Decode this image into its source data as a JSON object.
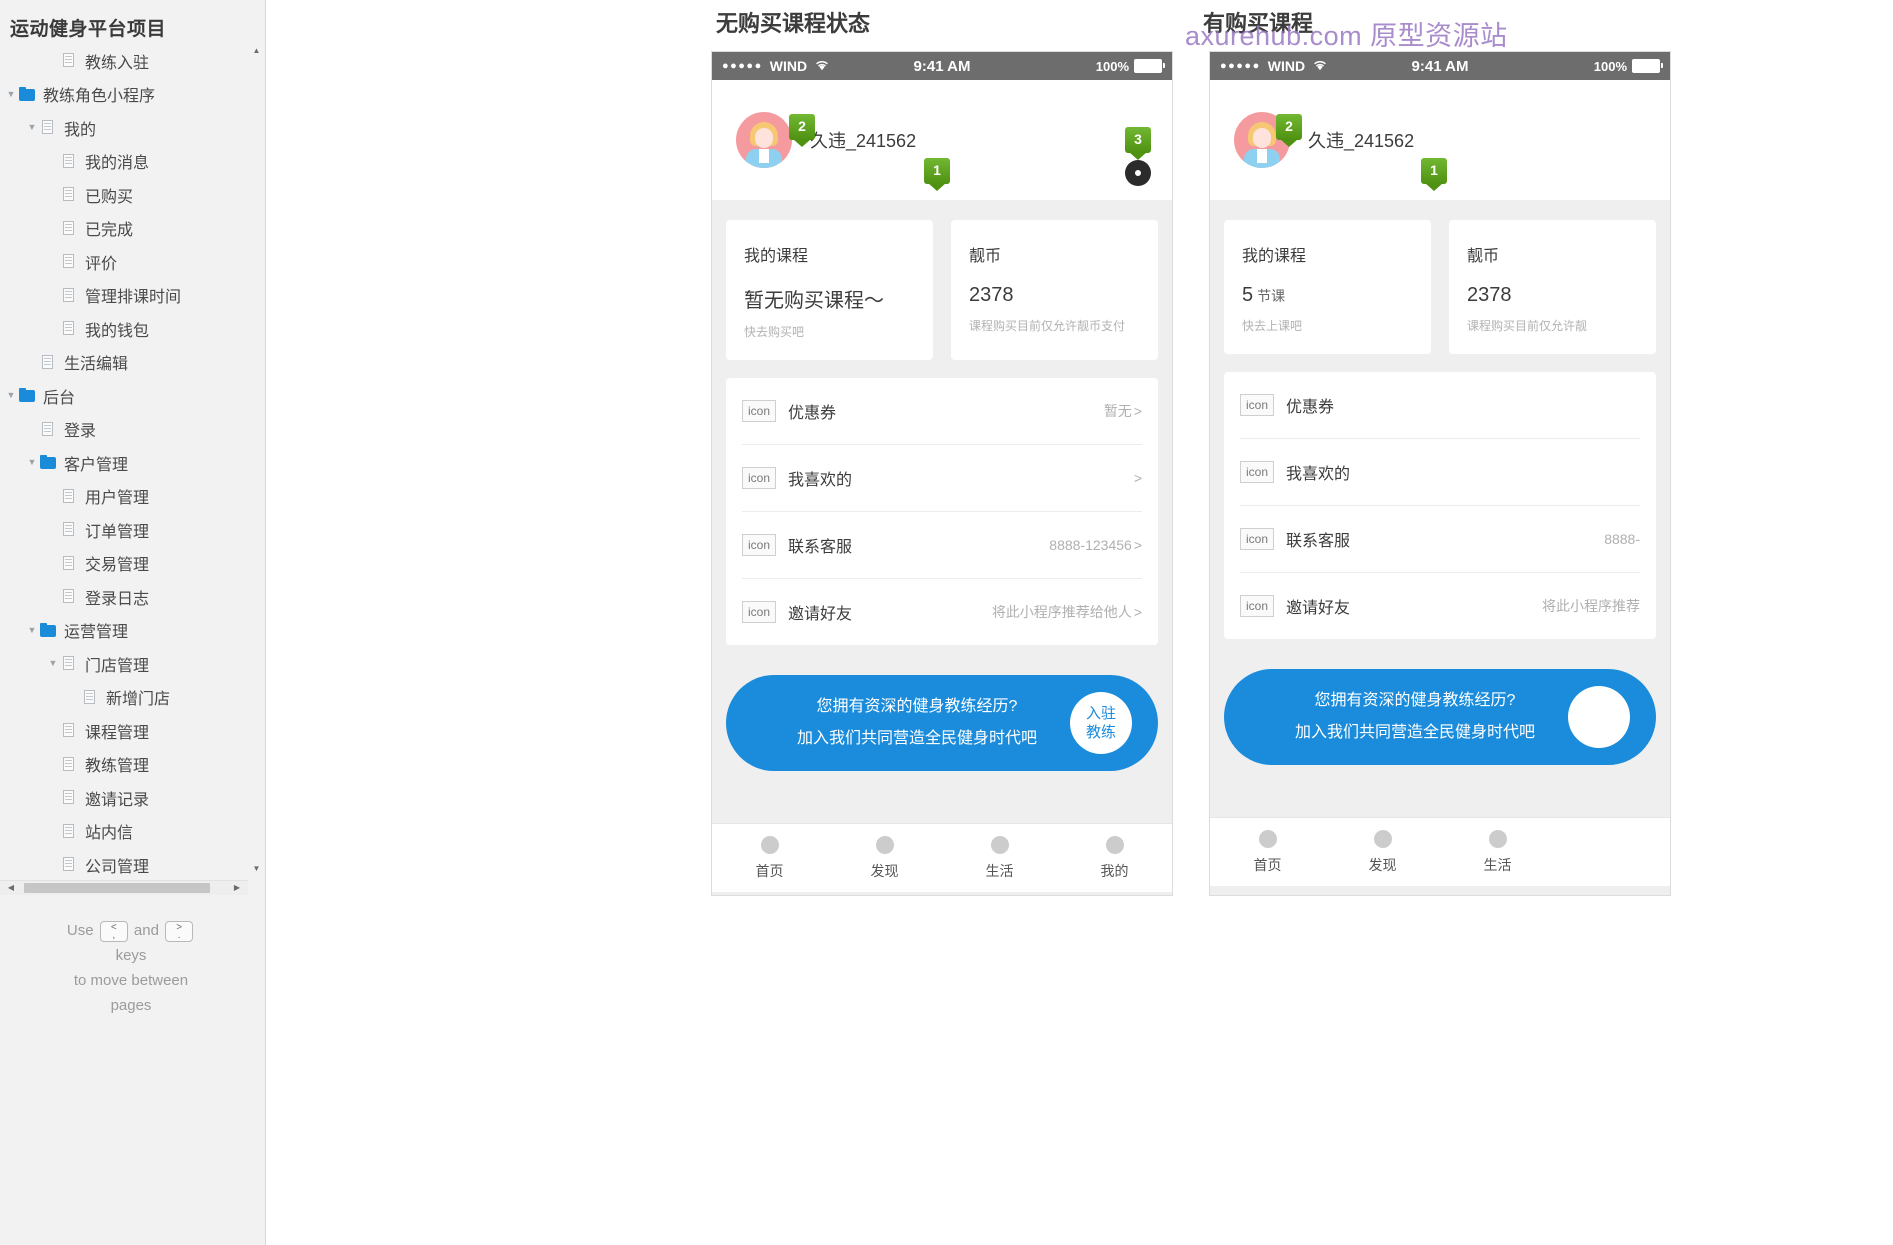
{
  "sidebar": {
    "title": "运动健身平台项目",
    "tree": [
      {
        "label": "教练入驻",
        "depth": 2,
        "icon": "page",
        "twisty": "none"
      },
      {
        "label": "教练角色小程序",
        "depth": 0,
        "icon": "folder",
        "twisty": "open"
      },
      {
        "label": "我的",
        "depth": 1,
        "icon": "page",
        "twisty": "open"
      },
      {
        "label": "我的消息",
        "depth": 2,
        "icon": "page",
        "twisty": "none"
      },
      {
        "label": "已购买",
        "depth": 2,
        "icon": "page",
        "twisty": "none"
      },
      {
        "label": "已完成",
        "depth": 2,
        "icon": "page",
        "twisty": "none"
      },
      {
        "label": "评价",
        "depth": 2,
        "icon": "page",
        "twisty": "none"
      },
      {
        "label": "管理排课时间",
        "depth": 2,
        "icon": "page",
        "twisty": "none"
      },
      {
        "label": "我的钱包",
        "depth": 2,
        "icon": "page",
        "twisty": "none"
      },
      {
        "label": "生活编辑",
        "depth": 1,
        "icon": "page",
        "twisty": "none"
      },
      {
        "label": "后台",
        "depth": 0,
        "icon": "folder",
        "twisty": "open"
      },
      {
        "label": "登录",
        "depth": 1,
        "icon": "page",
        "twisty": "none"
      },
      {
        "label": "客户管理",
        "depth": 1,
        "icon": "folder",
        "twisty": "open"
      },
      {
        "label": "用户管理",
        "depth": 2,
        "icon": "page",
        "twisty": "none"
      },
      {
        "label": "订单管理",
        "depth": 2,
        "icon": "page",
        "twisty": "none"
      },
      {
        "label": "交易管理",
        "depth": 2,
        "icon": "page",
        "twisty": "none"
      },
      {
        "label": "登录日志",
        "depth": 2,
        "icon": "page",
        "twisty": "none"
      },
      {
        "label": "运营管理",
        "depth": 1,
        "icon": "folder",
        "twisty": "open"
      },
      {
        "label": "门店管理",
        "depth": 2,
        "icon": "page",
        "twisty": "open"
      },
      {
        "label": "新增门店",
        "depth": 3,
        "icon": "page",
        "twisty": "none"
      },
      {
        "label": "课程管理",
        "depth": 2,
        "icon": "page",
        "twisty": "none"
      },
      {
        "label": "教练管理",
        "depth": 2,
        "icon": "page",
        "twisty": "none"
      },
      {
        "label": "邀请记录",
        "depth": 2,
        "icon": "page",
        "twisty": "none"
      },
      {
        "label": "站内信",
        "depth": 2,
        "icon": "page",
        "twisty": "none"
      },
      {
        "label": "公司管理",
        "depth": 2,
        "icon": "page",
        "twisty": "none"
      }
    ],
    "hint": {
      "use": "Use",
      "and": "and",
      "key_prev_top": "<",
      "key_prev_bottom": ",",
      "key_next_top": ">",
      "key_next_bottom": ".",
      "line2": "keys",
      "line3": "to move between",
      "line4": "pages"
    }
  },
  "watermark": "axurehub.com 原型资源站",
  "panels": [
    {
      "title": "无购买课程状态"
    },
    {
      "title": "有购买课程"
    }
  ],
  "phone_left": {
    "statusbar": {
      "dots": "●●●●●",
      "carrier": "WIND",
      "wifi": "wifi-icon",
      "time": "9:41 AM",
      "battery_text": "100%",
      "battery_icon": "battery-full-icon"
    },
    "profile": {
      "avatar": "user-avatar",
      "username": "久违_241562"
    },
    "markers": [
      {
        "id": "1",
        "label": "1"
      },
      {
        "id": "2",
        "label": "2"
      },
      {
        "id": "3",
        "label": "3"
      }
    ],
    "cards": [
      {
        "title": "我的课程",
        "value": "暂无购买课程～",
        "unit": "",
        "sub": "快去购买吧"
      },
      {
        "title": "靓币",
        "value": "2378",
        "unit": "",
        "sub": "课程购买目前仅允许靓币支付"
      }
    ],
    "menu": [
      {
        "icon": "icon",
        "label": "优惠券",
        "value": "暂无",
        "chev": ">"
      },
      {
        "icon": "icon",
        "label": "我喜欢的",
        "value": "",
        "chev": ">"
      },
      {
        "icon": "icon",
        "label": "联系客服",
        "value": "8888-123456",
        "chev": ">"
      },
      {
        "icon": "icon",
        "label": "邀请好友",
        "value": "将此小程序推荐给他人",
        "chev": ">"
      }
    ],
    "cta": {
      "line1": "您拥有资深的健身教练经历?",
      "line2": "加入我们共同营造全民健身时代吧",
      "badge_line1": "入驻",
      "badge_line2": "教练"
    },
    "tabs": [
      {
        "label": "首页"
      },
      {
        "label": "发现"
      },
      {
        "label": "生活"
      },
      {
        "label": "我的"
      }
    ]
  },
  "phone_right": {
    "statusbar": {
      "dots": "●●●●●",
      "carrier": "WIND",
      "wifi": "wifi-icon",
      "time": "9:41 AM",
      "battery_text": "100%",
      "battery_icon": "battery-full-icon"
    },
    "profile": {
      "avatar": "user-avatar",
      "username": "久违_241562"
    },
    "markers": [
      {
        "id": "1",
        "label": "1"
      },
      {
        "id": "2",
        "label": "2"
      }
    ],
    "cards": [
      {
        "title": "我的课程",
        "value": "5",
        "unit": "节课",
        "sub": "快去上课吧"
      },
      {
        "title": "靓币",
        "value": "2378",
        "unit": "",
        "sub": "课程购买目前仅允许靓"
      }
    ],
    "menu": [
      {
        "icon": "icon",
        "label": "优惠券",
        "value": "",
        "chev": ""
      },
      {
        "icon": "icon",
        "label": "我喜欢的",
        "value": "",
        "chev": ""
      },
      {
        "icon": "icon",
        "label": "联系客服",
        "value": "8888-",
        "chev": ""
      },
      {
        "icon": "icon",
        "label": "邀请好友",
        "value": "将此小程序推荐",
        "chev": ""
      }
    ],
    "cta": {
      "line1": "您拥有资深的健身教练经历?",
      "line2": "加入我们共同营造全民健身时代吧",
      "badge_line1": "",
      "badge_line2": ""
    },
    "tabs": [
      {
        "label": "首页"
      },
      {
        "label": "发现"
      },
      {
        "label": "生活"
      }
    ]
  }
}
